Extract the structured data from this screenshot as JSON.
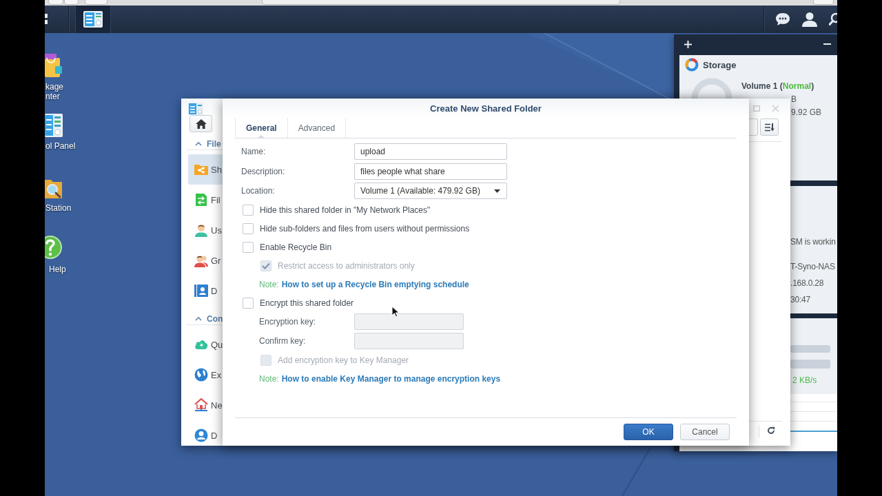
{
  "desktop": {
    "icons": [
      {
        "kind": "bag",
        "label": [
          "kage",
          "nter"
        ]
      },
      {
        "kind": "panel",
        "label": [
          "ol Panel"
        ]
      },
      {
        "kind": "folder-search",
        "label": [
          "Station"
        ]
      },
      {
        "kind": "help",
        "label": [
          "Help"
        ]
      }
    ]
  },
  "widgets": {
    "storage": {
      "title": "Storage",
      "volume": "Volume 1 (",
      "status": "Normal",
      "volume_end": ")",
      "used": "B",
      "available": "9.92 GB"
    },
    "system_health": {
      "lines": [
        "SM is workin",
        "T-Syno-NAS",
        ".168.0.28",
        "30:47"
      ]
    },
    "resource_monitor": {
      "speed": "2 KB/s"
    }
  },
  "control_panel": {
    "sections": [
      {
        "label": "File",
        "expanded": true,
        "items": [
          {
            "kind": "shared-folder",
            "label": "Sh",
            "selected": true
          },
          {
            "kind": "file-arrows",
            "label": "Fil",
            "selected": false
          },
          {
            "kind": "user",
            "label": "Us",
            "selected": false
          },
          {
            "kind": "group",
            "label": "Gr",
            "selected": false
          },
          {
            "kind": "contact-card",
            "label": "D",
            "selected": false
          }
        ]
      },
      {
        "label": "Con",
        "expanded": true,
        "items": [
          {
            "kind": "cloud",
            "label": "Qu",
            "selected": false
          },
          {
            "kind": "globe",
            "label": "Ex",
            "selected": false
          },
          {
            "kind": "house",
            "label": "Ne",
            "selected": false
          },
          {
            "kind": "user-circle",
            "label": "D",
            "selected": false
          }
        ]
      }
    ]
  },
  "dialog": {
    "title": "Create New Shared Folder",
    "tabs": [
      {
        "label": "General",
        "selected": true
      },
      {
        "label": "Advanced",
        "selected": false
      }
    ],
    "fields": [
      {
        "kind": "text",
        "label": "Name:",
        "value": "upload"
      },
      {
        "kind": "text",
        "label": "Description:",
        "value": "files people what share"
      },
      {
        "kind": "select",
        "label": "Location:",
        "value": "Volume 1 (Available: 479.92 GB)"
      }
    ],
    "options": [
      {
        "kind": "checkbox",
        "label": "Hide this shared folder in \"My Network Places\"",
        "checked": false,
        "disabled": false
      },
      {
        "kind": "checkbox",
        "label": "Hide sub-folders and files from users without permissions",
        "checked": false,
        "disabled": false
      },
      {
        "kind": "checkbox",
        "label": "Enable Recycle Bin",
        "checked": false,
        "disabled": false,
        "children": [
          {
            "kind": "checkbox",
            "label": "Restrict access to administrators only",
            "checked": true,
            "disabled": true
          },
          {
            "kind": "note",
            "prefix": "Note:",
            "link": "How to set up a Recycle Bin emptying schedule"
          }
        ]
      },
      {
        "kind": "checkbox",
        "label": "Encrypt this shared folder",
        "checked": false,
        "disabled": false,
        "children": [
          {
            "kind": "password",
            "label": "Encryption key:",
            "disabled": true
          },
          {
            "kind": "password",
            "label": "Confirm key:",
            "disabled": true
          },
          {
            "kind": "checkbox",
            "label": "Add encryption key to Key Manager",
            "checked": false,
            "disabled": true
          },
          {
            "kind": "note",
            "prefix": "Note:",
            "link": "How to enable Key Manager to manage encryption keys"
          }
        ]
      }
    ],
    "buttons": [
      {
        "kind": "primary",
        "label": "OK"
      },
      {
        "kind": "secondary",
        "label": "Cancel"
      }
    ]
  }
}
